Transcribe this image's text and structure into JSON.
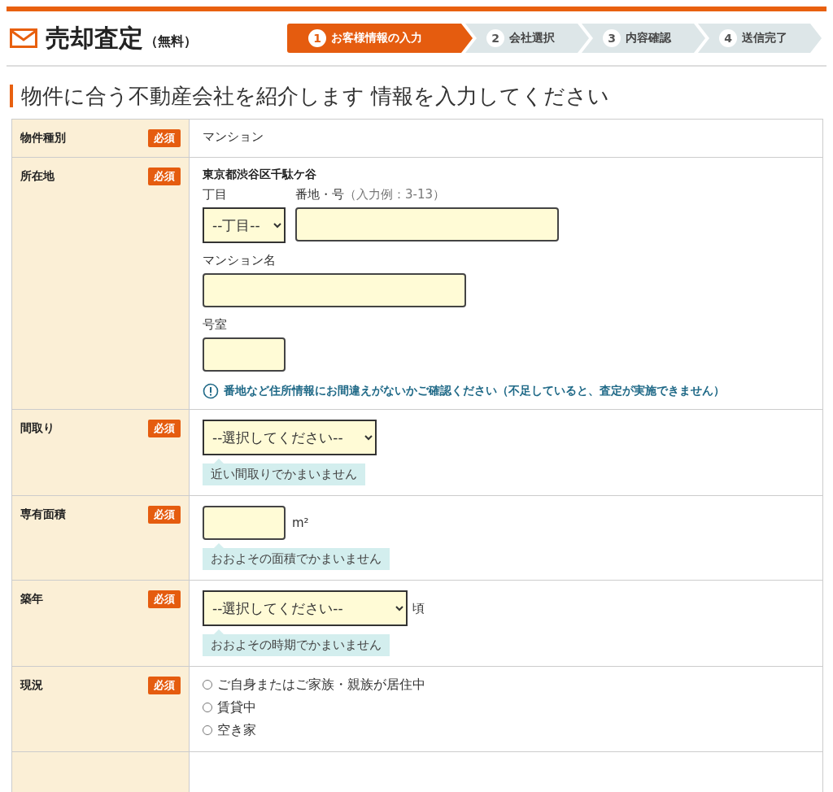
{
  "header": {
    "title": "売却査定",
    "subtitle": "（無料）"
  },
  "steps": [
    {
      "number": "1",
      "label": "お客様情報の入力",
      "selected": true
    },
    {
      "number": "2",
      "label": "会社選択",
      "selected": false
    },
    {
      "number": "3",
      "label": "内容確認",
      "selected": false
    },
    {
      "number": "4",
      "label": "送信完了",
      "selected": false
    }
  ],
  "heading": "物件に合う不動産会社を紹介します 情報を入力してください",
  "form": [
    {
      "kind": "text",
      "label": "物件種別",
      "badge": "必須",
      "value": "マンション"
    },
    {
      "kind": "address",
      "label": "所在地",
      "badge": "必須",
      "area": "東京都渋谷区千駄ケ谷",
      "chome_label": "丁目",
      "chome_value": "--丁目--",
      "banchi_label": "番地・号",
      "banchi_example": "（入力例：3-13）",
      "building_label": "マンション名",
      "room_label": "号室",
      "notice": "番地など住所情報にお間違えがないかご確認ください（不足していると、査定が実施できません）"
    },
    {
      "kind": "select",
      "label": "間取り",
      "badge": "必須",
      "value": "--選択してください--",
      "hint": "近い間取りでかまいません"
    },
    {
      "kind": "area",
      "label": "専有面積",
      "badge": "必須",
      "unit": "m²",
      "hint": "おおよその面積でかまいません"
    },
    {
      "kind": "year",
      "label": "築年",
      "badge": "必須",
      "value": "--選択してください--",
      "suffix": "頃",
      "hint": "おおよその時期でかまいません"
    },
    {
      "kind": "radio",
      "label": "現況",
      "badge": "必須",
      "options": [
        {
          "label": "ご自身またはご家族・親族が居住中",
          "selected": false
        },
        {
          "label": "賃貸中",
          "selected": false
        },
        {
          "label": "空き家",
          "selected": false
        }
      ]
    }
  ]
}
